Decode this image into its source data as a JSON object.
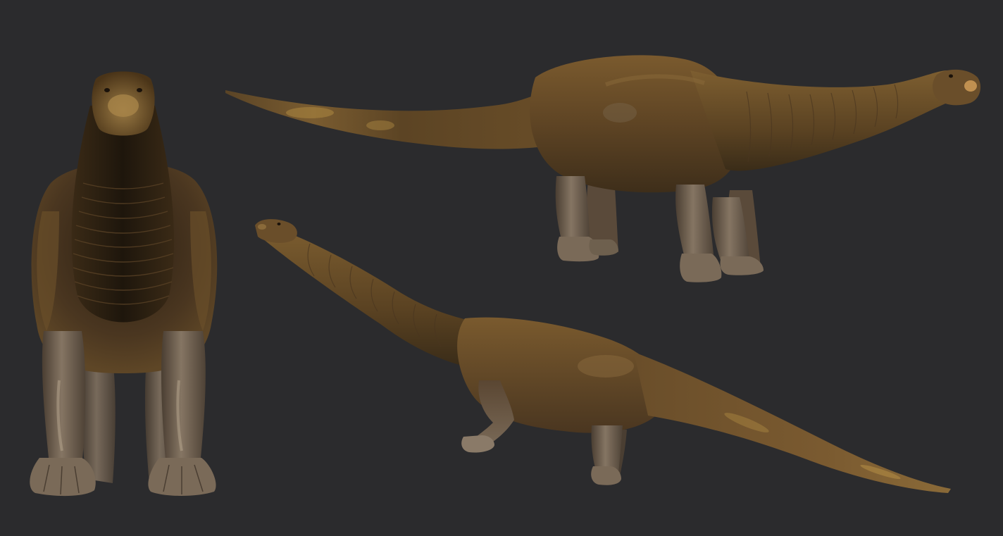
{
  "scene": {
    "background": "#2b2b2d",
    "models": [
      {
        "name": "sauropod-front-view",
        "view": "front"
      },
      {
        "name": "sauropod-side-view",
        "view": "side"
      },
      {
        "name": "sauropod-three-quarter-view",
        "view": "three-quarter"
      }
    ],
    "palette": {
      "skin_light": "#8a6a3a",
      "skin_mid": "#5e4422",
      "skin_dark": "#2a1e10",
      "leg_light": "#8a7a68",
      "leg_dark": "#4a3e32",
      "highlight": "#c09050",
      "tail_spot": "#a88440"
    }
  }
}
